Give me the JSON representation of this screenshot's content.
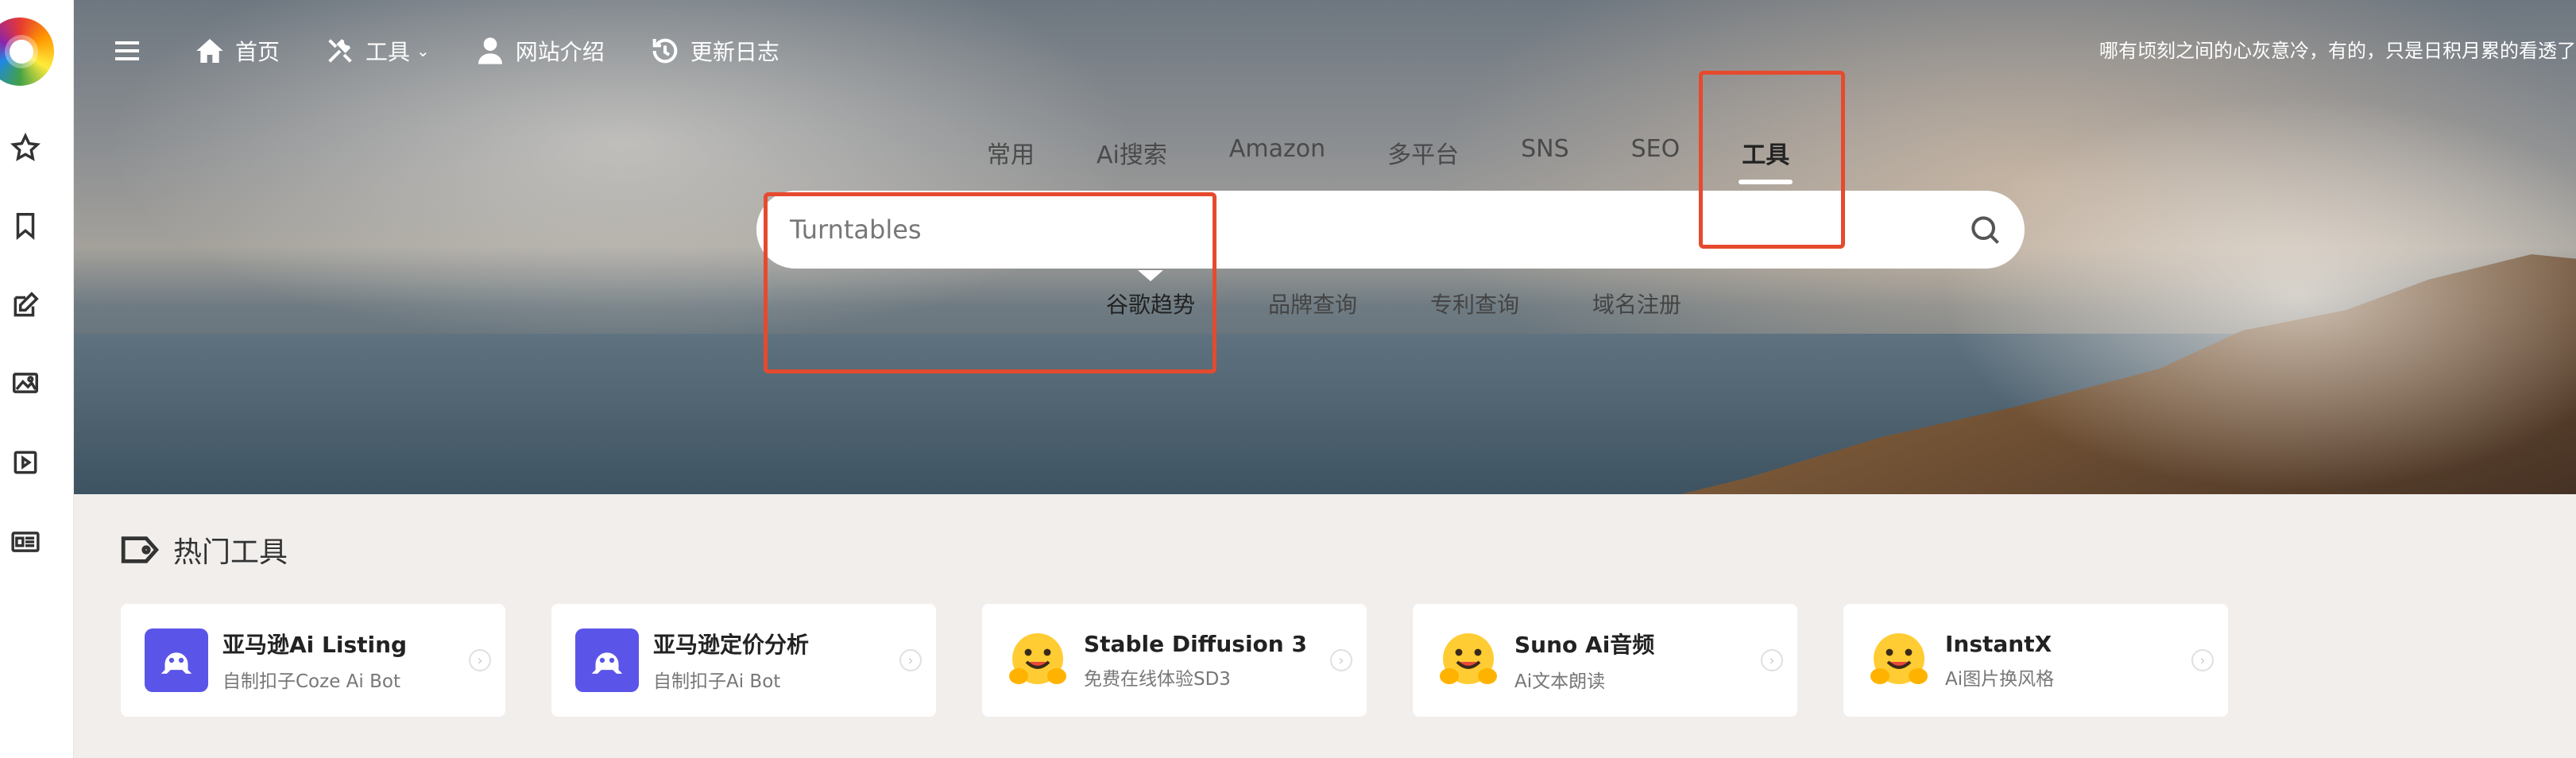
{
  "header": {
    "nav": [
      {
        "label": "首页",
        "icon": "home-icon"
      },
      {
        "label": "工具",
        "icon": "tools-icon",
        "caret": "⌄"
      },
      {
        "label": "网站介绍",
        "icon": "user-icon"
      },
      {
        "label": "更新日志",
        "icon": "history-icon"
      }
    ],
    "tagline": "哪有顷刻之间的心灰意冷，有的，只是日积月累的看透了"
  },
  "sidebar": {
    "icons": [
      "logo",
      "star-icon",
      "bookmark-icon",
      "edit-icon",
      "image-icon",
      "play-icon",
      "news-icon"
    ]
  },
  "search": {
    "tabs": [
      "常用",
      "Ai搜索",
      "Amazon",
      "多平台",
      "SNS",
      "SEO",
      "工具"
    ],
    "active_tab": "工具",
    "placeholder": "Turntables",
    "subtabs": [
      "谷歌趋势",
      "品牌查询",
      "专利查询",
      "域名注册"
    ],
    "active_subtab": "谷歌趋势"
  },
  "hot_tools": {
    "title": "热门工具",
    "cards": [
      {
        "name": "亚马逊Ai Listing",
        "desc": "自制扣子Coze Ai Bot",
        "icon": "coze-icon"
      },
      {
        "name": "亚马逊定价分析",
        "desc": "自制扣子Ai Bot",
        "icon": "coze-icon"
      },
      {
        "name": "Stable Diffusion 3",
        "desc": "免费在线体验SD3",
        "icon": "hugging-face-icon"
      },
      {
        "name": "Suno Ai音频",
        "desc": "Ai文本朗读",
        "icon": "hugging-face-icon"
      },
      {
        "name": "InstantX",
        "desc": "Ai图片换风格",
        "icon": "hugging-face-icon"
      }
    ]
  },
  "colors": {
    "annotation_red": "#e64a2e",
    "coze_purple": "#5a55e8",
    "page_bg": "#f1eeec"
  }
}
